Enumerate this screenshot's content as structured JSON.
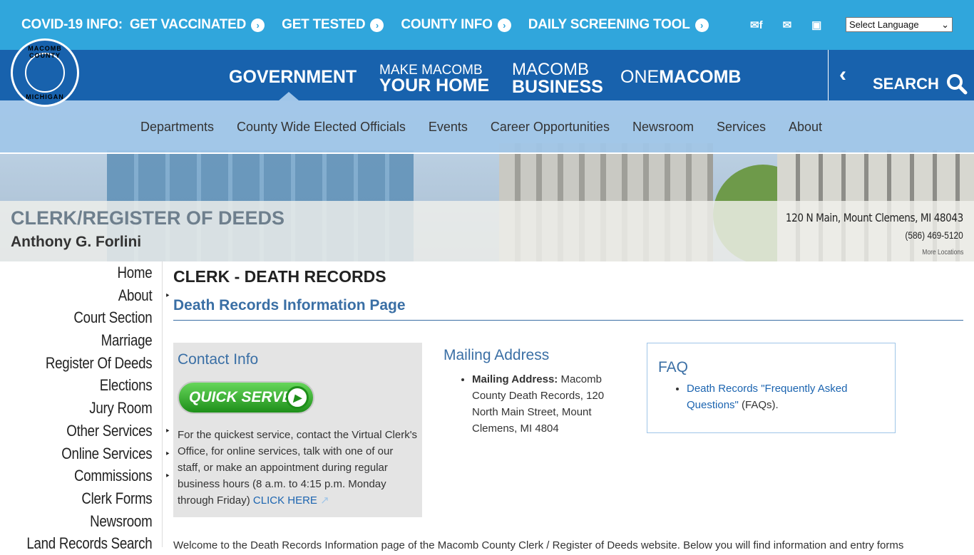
{
  "topbar": {
    "covid_label": "COVID-19 INFO:",
    "links": [
      "GET VACCINATED",
      "GET TESTED",
      "COUNTY INFO",
      "DAILY SCREENING TOOL"
    ],
    "language_select": "Select Language"
  },
  "logo": {
    "top_text": "MACOMB COUNTY",
    "bottom_text": "MICHIGAN"
  },
  "mainnav": {
    "government": "GOVERNMENT",
    "home_a": "MAKE MACOMB",
    "home_b": "YOUR HOME",
    "biz_a": "MACOMB",
    "biz_b": "BUSINESS",
    "one_a": "ONE",
    "one_b": "MACOMB",
    "search": "SEARCH"
  },
  "subnav": [
    "Departments",
    "County Wide Elected Officials",
    "Events",
    "Career Opportunities",
    "Newsroom",
    "Services",
    "About"
  ],
  "banner": {
    "dept": "CLERK/REGISTER OF DEEDS",
    "person": "Anthony G. Forlini",
    "address": "120 N Main, Mount Clemens, MI 48043",
    "phone": "(586) 469-5120",
    "more": "More Locations"
  },
  "sidebar": [
    {
      "label": "Home",
      "sub": false
    },
    {
      "label": "About",
      "sub": true
    },
    {
      "label": "Court Section",
      "sub": false
    },
    {
      "label": "Marriage",
      "sub": false
    },
    {
      "label": "Register Of Deeds",
      "sub": false
    },
    {
      "label": "Elections",
      "sub": false
    },
    {
      "label": "Jury Room",
      "sub": false
    },
    {
      "label": "Other Services",
      "sub": true
    },
    {
      "label": "Online Services",
      "sub": true
    },
    {
      "label": "Commissions",
      "sub": true
    },
    {
      "label": "Clerk Forms",
      "sub": false
    },
    {
      "label": "Newsroom",
      "sub": false
    },
    {
      "label": "Land Records Search",
      "sub": false
    }
  ],
  "content": {
    "title": "CLERK - DEATH RECORDS",
    "subtitle": "Death Records Information Page",
    "contact": {
      "heading": "Contact Info",
      "button": "QUICK SERVE",
      "text": "For the quickest service, contact the Virtual Clerk's Office, for online services, talk with one of our staff, or make an appointment during regular business hours (8 a.m. to 4:15 p.m. Monday through Friday)",
      "link": "CLICK HERE"
    },
    "mail": {
      "heading": "Mailing Address",
      "label": "Mailing Address:",
      "text": "Macomb County Death Records, 120 North Main Street, Mount Clemens, MI 4804"
    },
    "faq": {
      "heading": "FAQ",
      "link": "Death Records \"Frequently Asked Questions\"",
      "after": "(FAQs)."
    },
    "welcome": "Welcome to the Death Records Information page of the Macomb County Clerk / Register of Deeds website. Below you will find information and entry forms"
  }
}
